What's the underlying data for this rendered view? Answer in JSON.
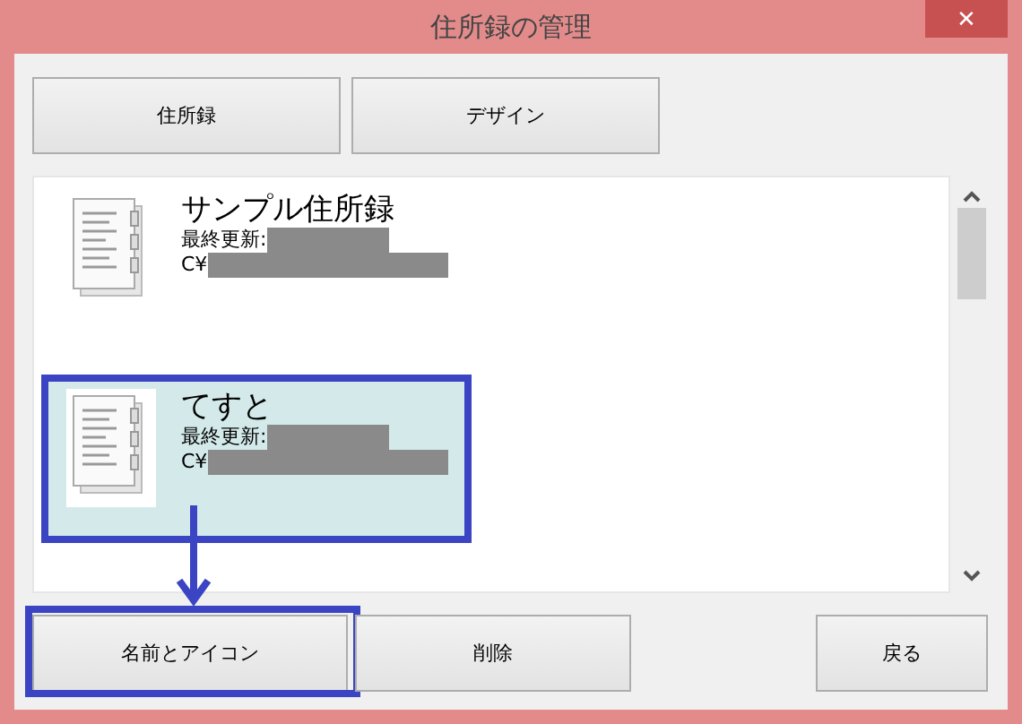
{
  "window": {
    "title": "住所録の管理",
    "close": "✕"
  },
  "tabs": [
    {
      "label": "住所録"
    },
    {
      "label": "デザイン"
    }
  ],
  "items": [
    {
      "name": "サンプル住所録",
      "updated_label": "最終更新:",
      "path": "C¥",
      "selected": false,
      "highlighted": false
    },
    {
      "name": "てすと",
      "updated_label": "最終更新:",
      "path": "C¥",
      "selected": true,
      "highlighted": true
    }
  ],
  "buttons": [
    {
      "label": "名前とアイコン",
      "highlighted": true
    },
    {
      "label": "削除",
      "highlighted": false
    },
    {
      "label": "戻る",
      "highlighted": false
    }
  ]
}
